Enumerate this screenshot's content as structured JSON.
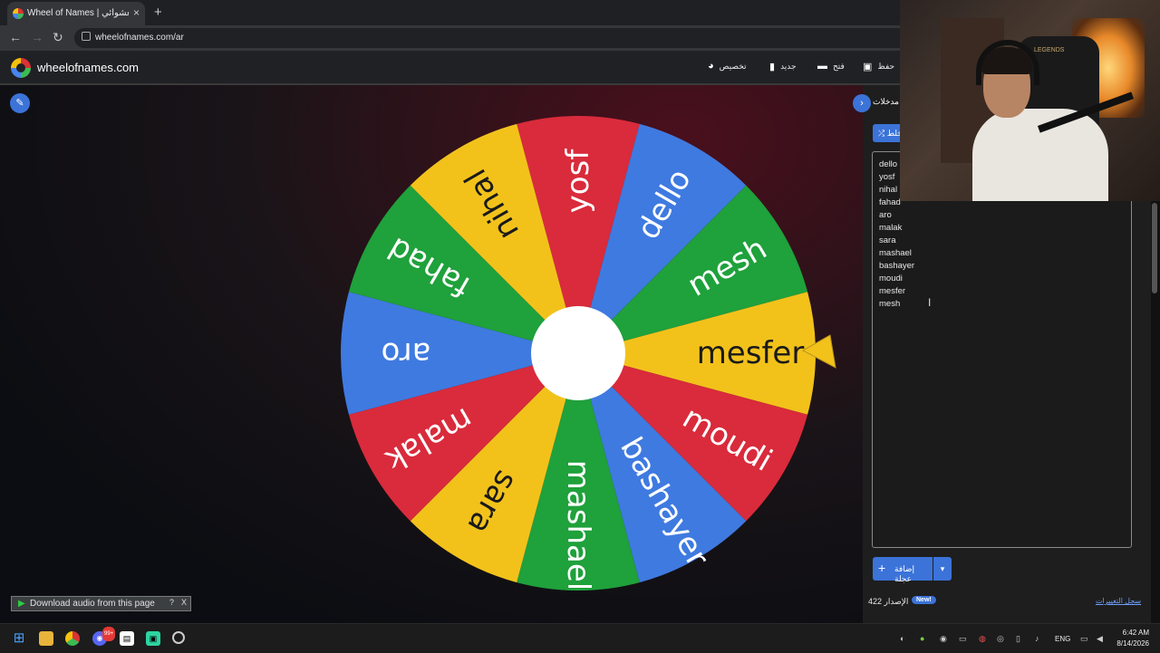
{
  "browser": {
    "tab_title": "Wheel of Names | اسم العشوائي",
    "tab_close": "×",
    "new_tab": "+",
    "url": "wheelofnames.com/ar",
    "back": "←",
    "forward": "→",
    "reload": "↻"
  },
  "header": {
    "logo": "wheelofnames.com",
    "menu": [
      {
        "label": "تخصيص",
        "icon": "palette-icon"
      },
      {
        "label": "جديد",
        "icon": "file-icon"
      },
      {
        "label": "فتح",
        "icon": "folder-icon"
      },
      {
        "label": "حفظ",
        "icon": "save-icon"
      }
    ]
  },
  "wheel": {
    "slices": [
      {
        "name": "yosf",
        "color": "#d92b3b"
      },
      {
        "name": "dello",
        "color": "#3f7ae0"
      },
      {
        "name": "mesh",
        "color": "#1fa13b"
      },
      {
        "name": "mesfer",
        "color": "#f2c21b"
      },
      {
        "name": "moudi",
        "color": "#d92b3b"
      },
      {
        "name": "bashayer",
        "color": "#3f7ae0"
      },
      {
        "name": "mashael",
        "color": "#1fa13b"
      },
      {
        "name": "sara",
        "color": "#f2c21b"
      },
      {
        "name": "malak",
        "color": "#d92b3b"
      },
      {
        "name": "aro",
        "color": "#3f7ae0"
      },
      {
        "name": "fahad",
        "color": "#1fa13b"
      },
      {
        "name": "nihal",
        "color": "#f2c21b"
      }
    ],
    "pointer_color": "#f2c21b"
  },
  "panel": {
    "tab_label": "مدخلات",
    "shuffle_label": "خلط",
    "entries": [
      "dello",
      "yosf",
      "nihal",
      "fahad",
      "aro",
      "malak",
      "sara",
      "mashael",
      "bashayer",
      "moudi",
      "mesfer",
      "mesh"
    ],
    "add_label": "إضافة عجلة",
    "dropdown": "▾",
    "version_label": "الإصدار 422",
    "new_badge": "New!",
    "changelog": "سجل التغييرات"
  },
  "download_bar": {
    "label": "Download audio from this page",
    "help": "?",
    "close": "X"
  },
  "webcam": {
    "chair_label": "LEGENDS"
  },
  "taskbar": {
    "lang": "ENG",
    "time": "6:42 AM",
    "date": "8/14/2026",
    "discord_badge": "99+"
  },
  "colors": {
    "accent": "#3b73d8",
    "red": "#d92b3b",
    "blue": "#3f7ae0",
    "green": "#1fa13b",
    "yellow": "#f2c21b"
  }
}
